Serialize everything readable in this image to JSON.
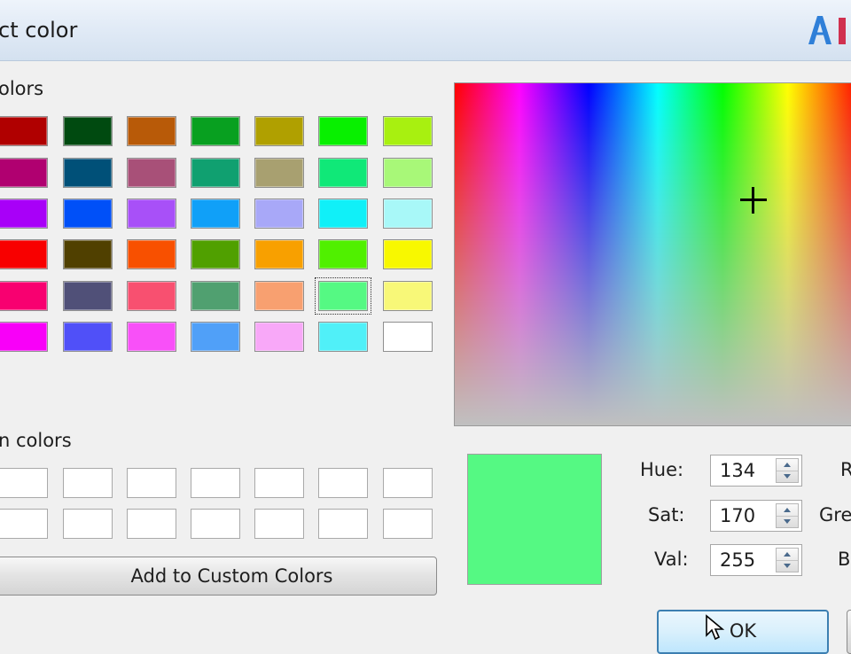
{
  "window": {
    "title": "ct color"
  },
  "basic_colors": {
    "label": "olors",
    "swatches": [
      [
        "#b00000",
        "#004a10",
        "#b85a08",
        "#08a020",
        "#b0a000",
        "#08f000",
        "#a8f010"
      ],
      [
        "#b00070",
        "#005078",
        "#a85078",
        "#10a070",
        "#a8a070",
        "#10e878",
        "#a8f878"
      ],
      [
        "#a800f8",
        "#0050f8",
        "#a850f8",
        "#10a0f8",
        "#a8a8f8",
        "#10f0f8",
        "#a8f8f8"
      ],
      [
        "#f80000",
        "#504000",
        "#f85000",
        "#50a000",
        "#f8a000",
        "#50f000",
        "#f8f800"
      ],
      [
        "#f80070",
        "#505078",
        "#f85070",
        "#50a070",
        "#f8a070",
        "#55f983",
        "#f8f878"
      ],
      [
        "#f800f8",
        "#5050f8",
        "#f850f8",
        "#50a0f8",
        "#f8a8f8",
        "#50f0f8",
        "#ffffff"
      ]
    ],
    "selected_row": 4,
    "selected_col": 5
  },
  "custom_colors": {
    "label": "n colors",
    "rows": 2,
    "cols": 7
  },
  "add_button": {
    "label": "Add to Custom Colors"
  },
  "spectrum": {
    "cursor_hue_fraction": 0.7,
    "cursor_sat_fraction": 0.67
  },
  "preview": {
    "color": "#55f983"
  },
  "fields": {
    "hue": {
      "label": "Hue:",
      "value": "134"
    },
    "sat": {
      "label": "Sat:",
      "value": "170"
    },
    "val": {
      "label": "Val:",
      "value": "255"
    },
    "red_label": "R",
    "green_label": "Gre",
    "blue_label": "B"
  },
  "buttons": {
    "ok_label": "OK"
  },
  "icons": {
    "logo": "brand-logo-icon",
    "spin": "spin-arrows-icon",
    "cursor": "mouse-pointer-icon"
  }
}
